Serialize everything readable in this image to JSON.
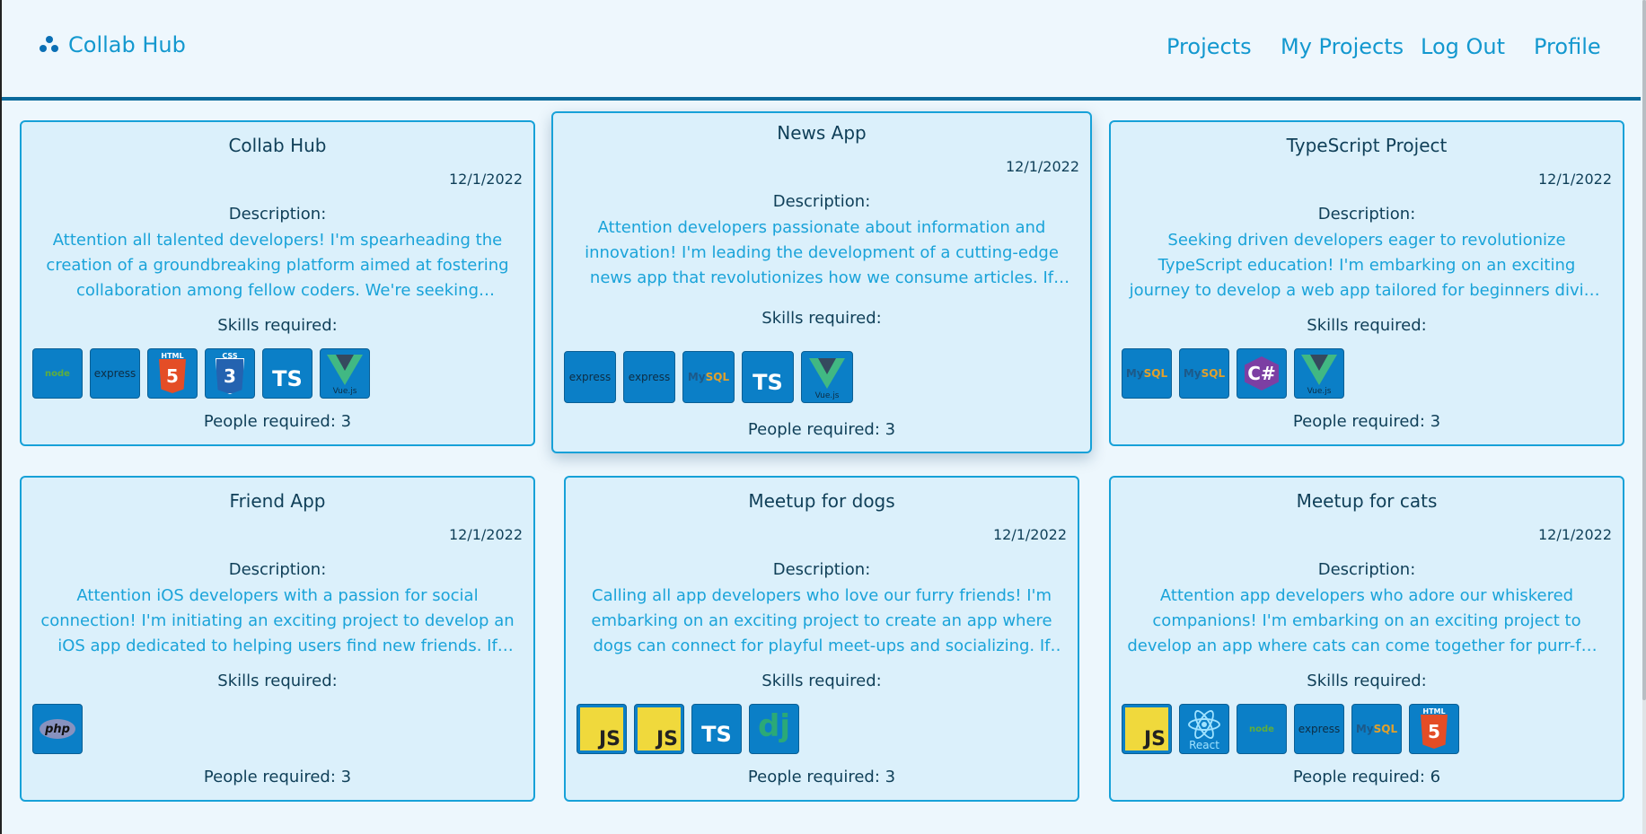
{
  "nav": {
    "brand": "Collab Hub",
    "links": [
      "Projects",
      "My Projects",
      "Log Out",
      "Profile"
    ]
  },
  "labels": {
    "description": "Description:",
    "skills": "Skills required:"
  },
  "cards": [
    {
      "title": "Collab Hub",
      "date": "12/1/2022",
      "description": "Attention all talented developers! I'm spearheading the creation of a groundbreaking platform aimed at fostering collaboration among fellow coders. We're seeking passionate individuals eager to join us.",
      "skills": [
        "node",
        "express",
        "html5",
        "css3",
        "typescript",
        "vue"
      ],
      "people": "People required: 3"
    },
    {
      "title": "News App",
      "date": "12/1/2022",
      "description": "Attention developers passionate about information and innovation! I'm leading the development of a cutting-edge news app that revolutionizes how we consume articles. If you're interested, join us.",
      "skills": [
        "express",
        "express",
        "mysql",
        "typescript",
        "vue"
      ],
      "people": "People required: 3"
    },
    {
      "title": "TypeScript Project",
      "date": "12/1/2022",
      "description": "Seeking driven developers eager to revolutionize TypeScript education! I'm embarking on an exciting journey to develop a web app tailored for beginners diving into TypeScript. If you're interested, join us.",
      "skills": [
        "mysql",
        "mysql",
        "csharp",
        "vue"
      ],
      "people": "People required: 3"
    },
    {
      "title": "Friend App",
      "date": "12/1/2022",
      "description": "Attention iOS developers with a passion for social connection! I'm initiating an exciting project to develop an iOS app dedicated to helping users find new friends. If you're enthusiastic about joining, reach out.",
      "skills": [
        "php"
      ],
      "people": "People required: 3"
    },
    {
      "title": "Meetup for dogs",
      "date": "12/1/2022",
      "description": "Calling all app developers who love our furry friends! I'm embarking on an exciting project to create an app where dogs can connect for playful meet-ups and socializing. If you're passionate, join us.",
      "skills": [
        "javascript",
        "javascript",
        "typescript",
        "django"
      ],
      "people": "People required: 3"
    },
    {
      "title": "Meetup for cats",
      "date": "12/1/2022",
      "description": "Attention app developers who adore our whiskered companions! I'm embarking on an exciting project to develop an app where cats can come together for purr-fect meet-ups and feline-friendly fun.",
      "skills": [
        "javascript",
        "react",
        "node",
        "express",
        "mysql",
        "html5"
      ],
      "people": "People required: 6"
    }
  ],
  "logo_text": {
    "express": "express",
    "node": "node",
    "ts": "TS",
    "js": "JS",
    "html": "HTML",
    "html_num": "5",
    "css": "CSS",
    "css_num": "3",
    "vue": "Vue.js",
    "mysql_a": "My",
    "mysql_b": "SQL",
    "csharp": "C#",
    "php": "php",
    "django": "dj",
    "react": "React"
  },
  "colors": {
    "accent": "#1398cf",
    "card_bg": "#dbf0fb",
    "card_border": "#17a1d8",
    "heading": "#0f3f58",
    "nav_border": "#0a6a9c"
  }
}
